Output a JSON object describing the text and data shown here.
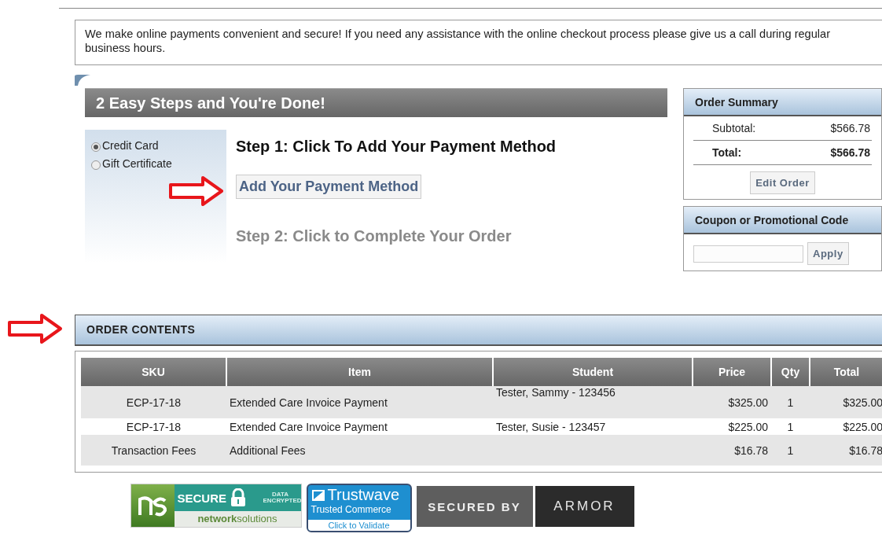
{
  "notice": "We make online payments convenient and secure! If you need any assistance with the online checkout process please give us a call during regular business hours.",
  "steps_header": "2 Easy Steps and You're Done!",
  "payment_options": [
    {
      "label": "Credit Card",
      "selected": true
    },
    {
      "label": "Gift Certificate",
      "selected": false
    }
  ],
  "steps": [
    {
      "title": "Step 1: Click To Add Your Payment Method",
      "disabled": false
    },
    {
      "title": "Step 2: Click to Complete Your Order",
      "disabled": true
    }
  ],
  "add_payment_button": "Add Your Payment Method",
  "order_summary": {
    "title": "Order Summary",
    "rows": [
      {
        "label": "Subtotal:",
        "value": "$566.78",
        "kind": "subtotal"
      },
      {
        "label": "Total:",
        "value": "$566.78",
        "kind": "total"
      }
    ],
    "button": "Edit Order"
  },
  "coupon": {
    "title": "Coupon or Promotional Code",
    "button": "Apply"
  },
  "order_contents": {
    "title": "ORDER CONTENTS",
    "columns": [
      "SKU",
      "Item",
      "Student",
      "Price",
      "Qty",
      "Total"
    ],
    "rows": [
      [
        "ECP-17-18",
        "Extended Care Invoice Payment",
        "Tester, Sammy - 123456",
        "$325.00",
        "1",
        "$325.00"
      ],
      [
        "ECP-17-18",
        "Extended Care Invoice Payment",
        "Tester, Susie - 123457",
        "$225.00",
        "1",
        "$225.00"
      ],
      [
        "Transaction Fees",
        "Additional Fees",
        "",
        "$16.78",
        "1",
        "$16.78"
      ]
    ]
  },
  "badges": {
    "network_solutions": {
      "secure": "SECURE",
      "encrypted": "DATA ENCRYPTED",
      "brand": "**network**solutions"
    },
    "trustwave": {
      "brand": "Trustwave",
      "line": "Trusted Commerce",
      "link": "Click to Validate"
    },
    "armor": {
      "label": "SECURED BY",
      "brand": "ARMOR"
    }
  }
}
